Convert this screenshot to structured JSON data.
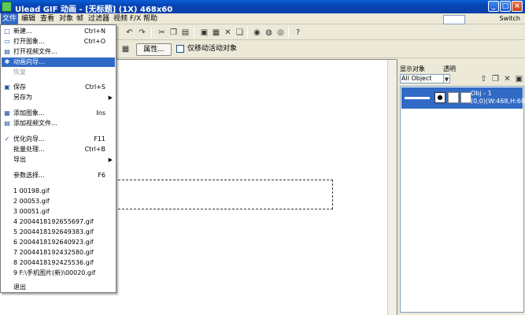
{
  "window": {
    "title": "Ulead GIF 动画 - [无标题] (1X) 468x60",
    "min": "_",
    "max": "□",
    "close": "×"
  },
  "menubar": {
    "items": [
      "文件",
      "编辑",
      "查看",
      "对象",
      "帧",
      "过滤器",
      "视频 F/X",
      "帮助"
    ],
    "switch": "Switch"
  },
  "toolbar2": {
    "properties": "属性...",
    "move_only_active_label": "仅移动活动对象"
  },
  "file_menu": {
    "items": [
      {
        "label": "新建...",
        "shortcut": "Ctrl+N",
        "icon": "new-doc-icon",
        "glyph": "□"
      },
      {
        "label": "打开图象...",
        "shortcut": "Ctrl+O",
        "icon": "open-folder-icon",
        "glyph": "▭"
      },
      {
        "label": "打开视频文件...",
        "shortcut": "",
        "icon": "video-icon",
        "glyph": "▤"
      },
      {
        "label": "动画向导...",
        "shortcut": "",
        "icon": "wizard-icon",
        "glyph": "✱"
      },
      {
        "label": "恢复",
        "shortcut": "",
        "icon": "",
        "glyph": ""
      },
      {
        "label": "保存",
        "shortcut": "Ctrl+S",
        "icon": "save-icon",
        "glyph": "▣"
      },
      {
        "label": "另存为",
        "shortcut": "",
        "icon": "",
        "glyph": ""
      },
      {
        "label": "添加图象...",
        "shortcut": "Ins",
        "icon": "add-image-icon",
        "glyph": "▦"
      },
      {
        "label": "添加视频文件...",
        "shortcut": "",
        "icon": "add-video-icon",
        "glyph": "▤"
      },
      {
        "label": "优化向导...",
        "shortcut": "F11",
        "icon": "optimize-icon",
        "glyph": "✓"
      },
      {
        "label": "批量处理...",
        "shortcut": "Ctrl+B",
        "icon": "",
        "glyph": ""
      },
      {
        "label": "导出",
        "shortcut": "",
        "icon": "",
        "glyph": ""
      },
      {
        "label": "参数选择...",
        "shortcut": "F6",
        "icon": "",
        "glyph": ""
      },
      {
        "label": "1 00198.gif",
        "shortcut": ""
      },
      {
        "label": "2 00053.gif",
        "shortcut": ""
      },
      {
        "label": "3 00051.gif",
        "shortcut": ""
      },
      {
        "label": "4 20044181926556​97.gif",
        "shortcut": ""
      },
      {
        "label": "5 2004418192649383.gif",
        "shortcut": ""
      },
      {
        "label": "6 2004418192640923.gif",
        "shortcut": ""
      },
      {
        "label": "7 2004418192432580.gif",
        "shortcut": ""
      },
      {
        "label": "8 2004418192425536.gif",
        "shortcut": ""
      },
      {
        "label": "9 F:\\手机图片(新)\\00020.gif",
        "shortcut": ""
      },
      {
        "label": "退出",
        "shortcut": ""
      }
    ]
  },
  "object_panel": {
    "display_label": "显示对象",
    "opacity_label": "透明",
    "selector_value": "All Object",
    "object_name": "Obj - 1",
    "object_coords": "(0,0)(W:468,H:60)"
  }
}
